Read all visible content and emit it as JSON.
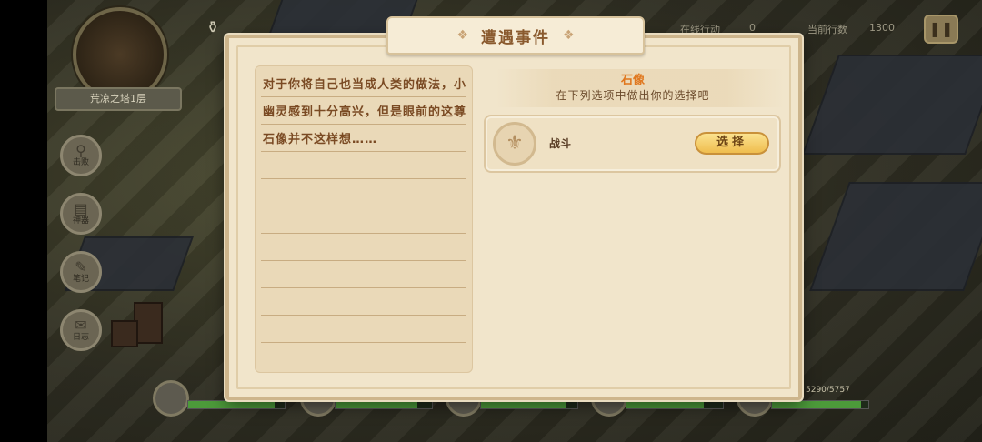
{
  "hud": {
    "minimap_label": "荒凉之塔1层",
    "side_buttons": [
      "击败",
      "神器",
      "笔记",
      "日志"
    ],
    "top_right_a": "在线行动",
    "top_right_a_value": "0",
    "top_right_b": "当前行数",
    "top_right_b_value": "1300",
    "pause_icon": "pause-icon",
    "hp_readout": "5290/5757"
  },
  "dialog": {
    "title": "遭遇事件",
    "story_text": "对于你将自己也当成人类的做法，小幽灵感到十分高兴，但是眼前的这尊石像并不这样想……",
    "choice_title": "石像",
    "choice_subtitle": "在下列选项中做出你的选择吧",
    "options": [
      {
        "label": "战斗",
        "button": "选择",
        "icon": "statue-emblem-icon"
      }
    ]
  },
  "party": {
    "hp_fractions": [
      0.9,
      0.85,
      0.88,
      0.8,
      0.92
    ]
  },
  "colors": {
    "accent_orange": "#e0771e",
    "text_brown": "#7a4a23",
    "button_gold": "#efbd4e",
    "hp_green": "#4c9a3a"
  }
}
